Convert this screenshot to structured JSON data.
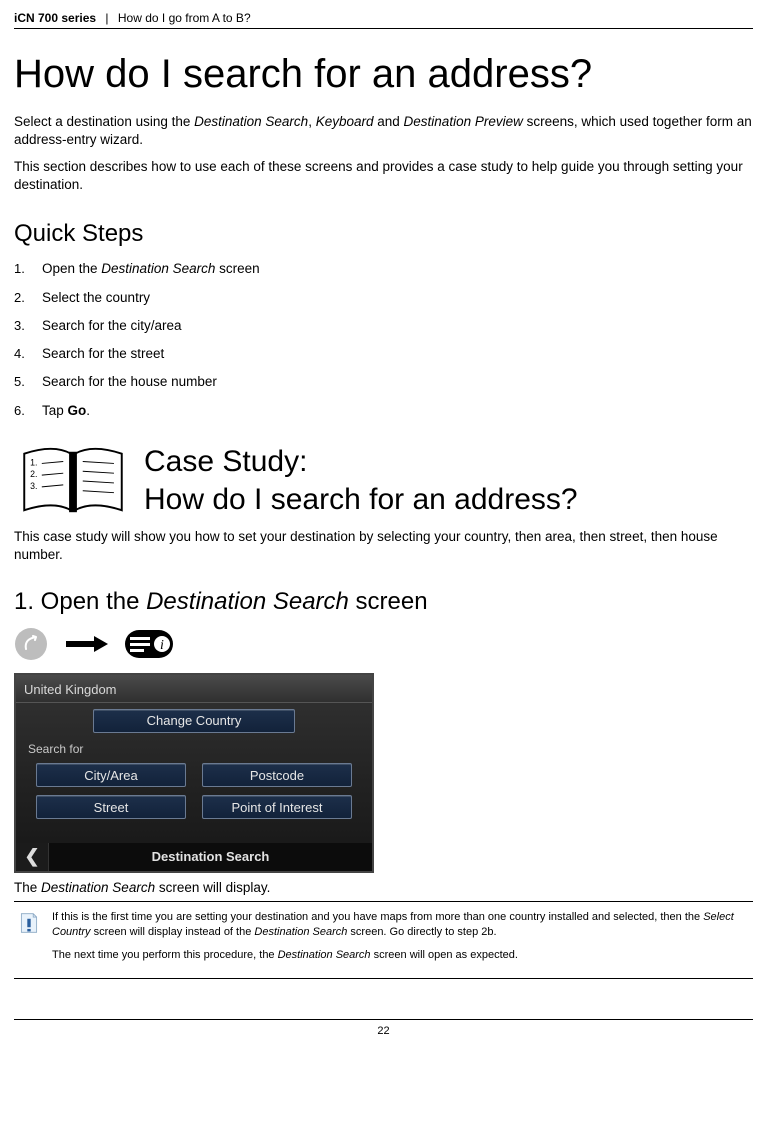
{
  "header": {
    "series": "iCN 700 series",
    "chapter": "How do I go from A to B?"
  },
  "title": "How do I search for an address?",
  "intro1_a": "Select a destination using the ",
  "intro1_ds": "Destination Search",
  "intro1_b": ", ",
  "intro1_kb": "Keyboard",
  "intro1_c": " and ",
  "intro1_dp": "Destination Preview",
  "intro1_d": " screens, which used together form an address-entry wizard.",
  "intro2": "This section describes how to use each of these screens and provides a case study to help guide you through setting your destination.",
  "quick_steps_heading": "Quick Steps",
  "steps": [
    {
      "n": "1.",
      "pre": "Open the ",
      "ital": "Destination Search",
      "post": " screen"
    },
    {
      "n": "2.",
      "pre": "Select the country",
      "ital": "",
      "post": ""
    },
    {
      "n": "3.",
      "pre": "Search for the city/area",
      "ital": "",
      "post": ""
    },
    {
      "n": "4.",
      "pre": "Search for the street",
      "ital": "",
      "post": ""
    },
    {
      "n": "5.",
      "pre": "Search for the house number",
      "ital": "",
      "post": ""
    },
    {
      "n": "6.",
      "pre": "Tap ",
      "bold": "Go",
      "post": "."
    }
  ],
  "case_line1": "Case Study:",
  "case_line2": "How do I search for an address?",
  "case_intro": "This case study will show you how to set your destination by selecting your country, then area, then street, then house number.",
  "substep_prefix": "1. Open the ",
  "substep_ital": "Destination Search",
  "substep_suffix": " screen",
  "device": {
    "country": "United Kingdom",
    "change_country": "Change Country",
    "search_for": "Search for",
    "buttons": {
      "city": "City/Area",
      "postcode": "Postcode",
      "street": "Street",
      "poi": "Point of Interest"
    },
    "footer": "Destination Search"
  },
  "caption_a": "The ",
  "caption_ital": "Destination Search",
  "caption_b": " screen will display.",
  "note1_a": "If this is the first time you are setting your destination and you have maps from more than one country installed and selected, then the ",
  "note1_sc": "Select Country",
  "note1_b": " screen will display instead of the ",
  "note1_ds": "Destination Search",
  "note1_c": " screen. Go directly to step 2b.",
  "note2_a": "The next time you perform this procedure, the ",
  "note2_ds": "Destination Search",
  "note2_b": " screen will open as expected.",
  "page_number": "22"
}
